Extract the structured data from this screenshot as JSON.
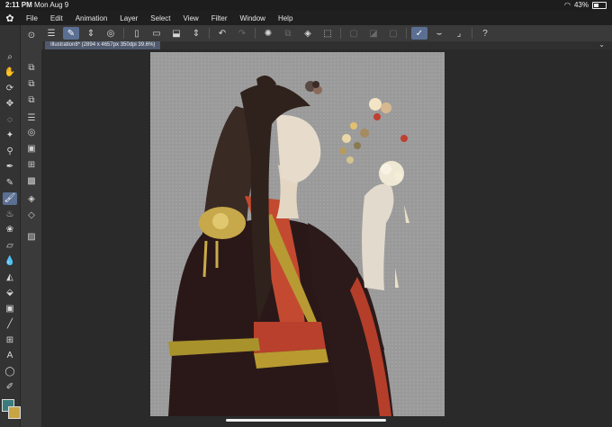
{
  "status": {
    "time": "2:11 PM",
    "date": "Mon Aug 9",
    "battery": "43%",
    "battery_level": 0.43
  },
  "menu": {
    "items": [
      "File",
      "Edit",
      "Animation",
      "Layer",
      "Select",
      "View",
      "Filter",
      "Window",
      "Help"
    ]
  },
  "document": {
    "tab_label": "Illustration8* (2894 x 4657px 350dpi 39.6%)"
  },
  "colors": {
    "main": "#3b7b7b",
    "sub": "#c8a544",
    "accent": "#5b6f93"
  },
  "tools": [
    {
      "name": "magnifier-icon",
      "glyph": "⌕"
    },
    {
      "name": "hand-icon",
      "glyph": "✋"
    },
    {
      "name": "rotate-icon",
      "glyph": "⟳"
    },
    {
      "name": "move-icon",
      "glyph": "✥"
    },
    {
      "name": "lasso-select-icon",
      "glyph": "◌"
    },
    {
      "name": "magic-wand-icon",
      "glyph": "✦"
    },
    {
      "name": "eyedropper-icon",
      "glyph": "⚲"
    },
    {
      "name": "pen-icon",
      "glyph": "✒"
    },
    {
      "name": "pencil-icon",
      "glyph": "✎"
    },
    {
      "name": "brush-icon",
      "glyph": "🖌"
    },
    {
      "name": "airbrush-icon",
      "glyph": "♨"
    },
    {
      "name": "decoration-icon",
      "glyph": "❀"
    },
    {
      "name": "eraser-icon",
      "glyph": "▱"
    },
    {
      "name": "blend-icon",
      "glyph": "💧"
    },
    {
      "name": "fill-icon",
      "glyph": "◭"
    },
    {
      "name": "fill-bucket-icon",
      "glyph": "⬙"
    },
    {
      "name": "gradient-icon",
      "glyph": "▣"
    },
    {
      "name": "figure-icon",
      "glyph": "╱"
    },
    {
      "name": "frame-icon",
      "glyph": "⊞"
    },
    {
      "name": "text-icon",
      "glyph": "A"
    },
    {
      "name": "balloon-icon",
      "glyph": "◯"
    },
    {
      "name": "correct-line-icon",
      "glyph": "✐"
    }
  ]
}
